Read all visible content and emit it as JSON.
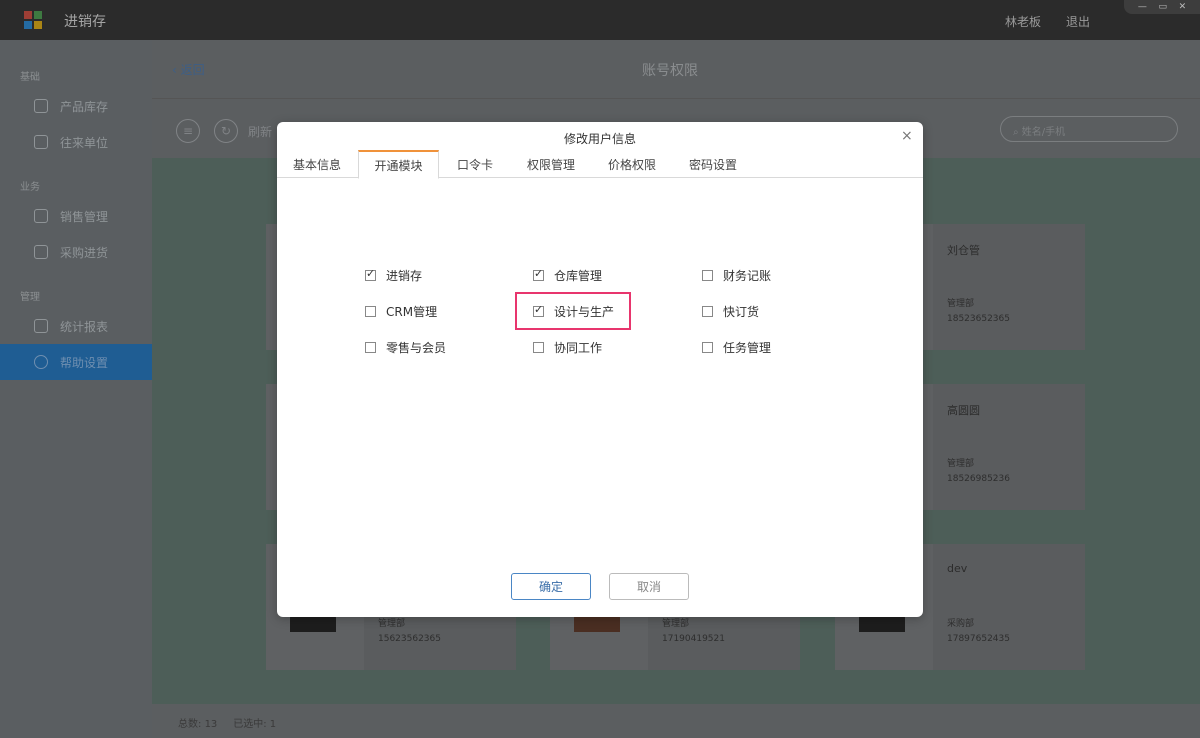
{
  "app": {
    "title": "进销存",
    "user_name": "林老板",
    "logout": "退出",
    "logo_colors": [
      "#e94b3c",
      "#4caf50",
      "#2196f3",
      "#ffc107"
    ]
  },
  "window_controls": [
    "—",
    "▭",
    "✕"
  ],
  "sidebar": {
    "groups": [
      {
        "label": "基础",
        "items": [
          {
            "label": "产品库存",
            "icon": "tag-icon"
          },
          {
            "label": "往来单位",
            "icon": "contacts-icon"
          }
        ]
      },
      {
        "label": "业务",
        "items": [
          {
            "label": "销售管理",
            "icon": "edit-icon"
          },
          {
            "label": "采购进货",
            "icon": "inbox-icon"
          }
        ]
      },
      {
        "label": "管理",
        "items": [
          {
            "label": "统计报表",
            "icon": "chart-icon"
          },
          {
            "label": "帮助设置",
            "icon": "gear-icon",
            "active": true
          }
        ]
      }
    ]
  },
  "main": {
    "back": "返回",
    "page_title": "账号权限",
    "toolbar": {
      "refresh": "刷新",
      "search_placeholder": "姓名/手机"
    },
    "cards": [
      {
        "name": "刘仓管",
        "dept": "管理部",
        "phone": "18523652365"
      },
      {
        "name": "高圆圆",
        "dept": "管理部",
        "phone": "18526985236"
      },
      {
        "name": "",
        "dept": "管理部",
        "phone": "15623562365"
      },
      {
        "name": "",
        "dept": "管理部",
        "phone": "17190419521"
      },
      {
        "name": "dev",
        "dept": "采购部",
        "phone": "17897652435"
      }
    ],
    "footer": {
      "total_label": "总数:",
      "total": "13",
      "selected_label": "已选中:",
      "selected": "1"
    }
  },
  "modal": {
    "title": "修改用户信息",
    "close": "×",
    "tabs": [
      "基本信息",
      "开通模块",
      "口令卡",
      "权限管理",
      "价格权限",
      "密码设置"
    ],
    "active_tab": 1,
    "modules": [
      {
        "label": "进销存",
        "checked": true
      },
      {
        "label": "仓库管理",
        "checked": true
      },
      {
        "label": "财务记账",
        "checked": false
      },
      {
        "label": "CRM管理",
        "checked": false
      },
      {
        "label": "设计与生产",
        "checked": true,
        "highlighted": true
      },
      {
        "label": "快订货",
        "checked": false
      },
      {
        "label": "零售与会员",
        "checked": false
      },
      {
        "label": "协同工作",
        "checked": false
      },
      {
        "label": "任务管理",
        "checked": false
      }
    ],
    "ok": "确定",
    "cancel": "取消",
    "highlight_color": "#e8356d"
  }
}
